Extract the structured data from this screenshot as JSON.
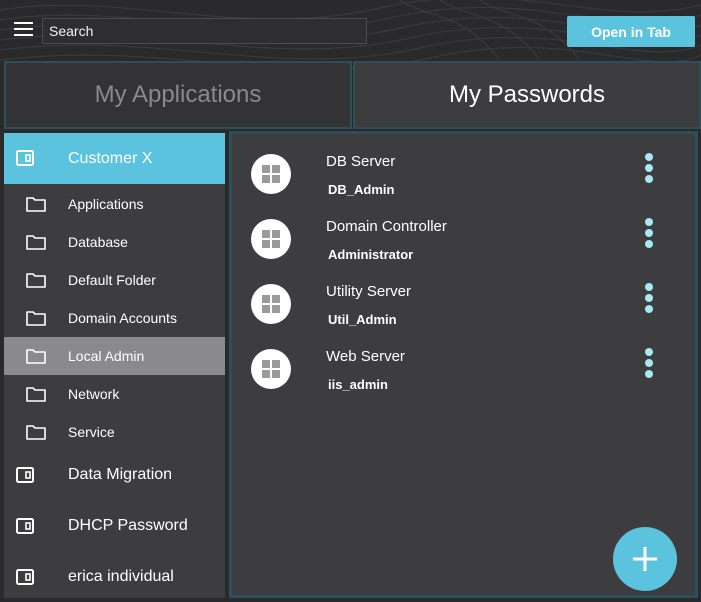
{
  "toolbar": {
    "search_placeholder": "Search",
    "open_tab_label": "Open in Tab"
  },
  "tabs": {
    "applications": "My Applications",
    "passwords": "My Passwords"
  },
  "sidebar": {
    "selected_group": "Customer X",
    "folders": [
      {
        "label": "Applications",
        "active": false
      },
      {
        "label": "Database",
        "active": false
      },
      {
        "label": "Default Folder",
        "active": false
      },
      {
        "label": "Domain Accounts",
        "active": false
      },
      {
        "label": "Local Admin",
        "active": true
      },
      {
        "label": "Network",
        "active": false
      },
      {
        "label": "Service",
        "active": false
      }
    ],
    "groups": [
      {
        "label": "Data Migration"
      },
      {
        "label": "DHCP Password"
      },
      {
        "label": "erica individual"
      }
    ]
  },
  "entries": [
    {
      "title": "DB Server",
      "username": "DB_Admin",
      "icon": "windows-icon"
    },
    {
      "title": "Domain Controller",
      "username": "Administrator",
      "icon": "windows-icon"
    },
    {
      "title": "Utility Server",
      "username": "Util_Admin",
      "icon": "windows-icon"
    },
    {
      "title": "Web Server",
      "username": "iis_admin",
      "icon": "windows-icon"
    }
  ],
  "colors": {
    "accent": "#5bc3dd",
    "panel": "#3d3d3f",
    "border": "#2d4f57",
    "active_folder": "#8a8a8c"
  }
}
